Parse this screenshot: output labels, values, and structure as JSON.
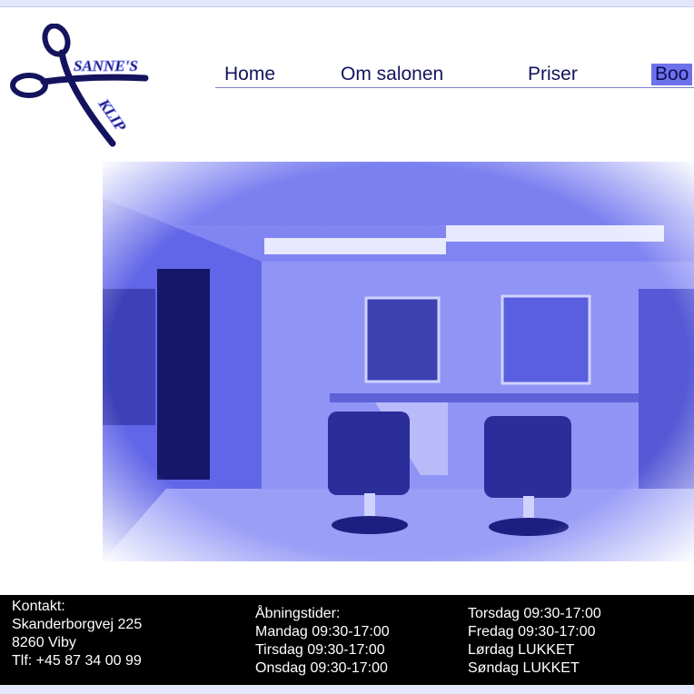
{
  "logo": {
    "brand_top": "SANNE'S",
    "brand_bottom": "KLIP"
  },
  "nav": {
    "items": [
      {
        "label": "Home"
      },
      {
        "label": "Om salonen"
      },
      {
        "label": "Priser"
      },
      {
        "label": "Boo"
      }
    ]
  },
  "footer": {
    "contact": {
      "heading": "Kontakt:",
      "street": "Skanderborgvej 225",
      "city": "8260 Viby",
      "phone": "Tlf: +45 87 34 00 99"
    },
    "hours_left": {
      "heading": "Åbningstider:",
      "mon": "Mandag 09:30-17:00",
      "tue": "Tirsdag 09:30-17:00",
      "wed": "Onsdag 09:30-17:00"
    },
    "hours_right": {
      "thu": "Torsdag 09:30-17:00",
      "fri": "Fredag 09:30-17:00",
      "sat": "Lørdag LUKKET",
      "sun": "Søndag LUKKET"
    }
  },
  "colors": {
    "brand": "#13135e",
    "accent": "#6d72ea",
    "photo_tint": "#4a4ee8",
    "footer_bg": "#000000"
  }
}
